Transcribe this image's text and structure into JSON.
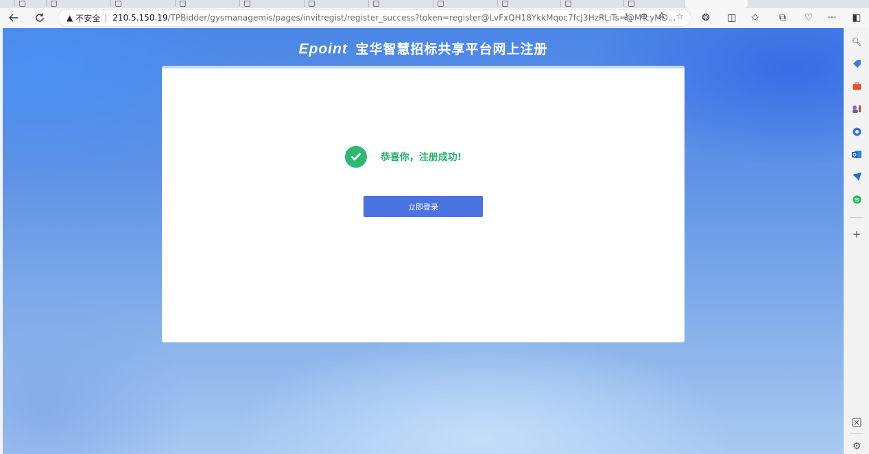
{
  "browser": {
    "address_bar": {
      "security_label": "不安全",
      "separator": "|",
      "url_host": "210.5.150.19",
      "url_path": "/TPBidder/gysmanagemis/pages/invitregist/register_success?token=register@LvFxQH18YkkMqoc7fcJ3HzRLiTs=@MTcyMD..."
    },
    "toolbar": {
      "more_label": "···",
      "add_label": "+"
    }
  },
  "page": {
    "header": {
      "brand": "Epoint",
      "title": "宝华智慧招标共享平台网上注册"
    },
    "success_message": "恭喜你，注册成功!",
    "login_button_label": "立即登录"
  },
  "colors": {
    "success_green": "#28b36b",
    "button_blue": "#4a72e0"
  }
}
